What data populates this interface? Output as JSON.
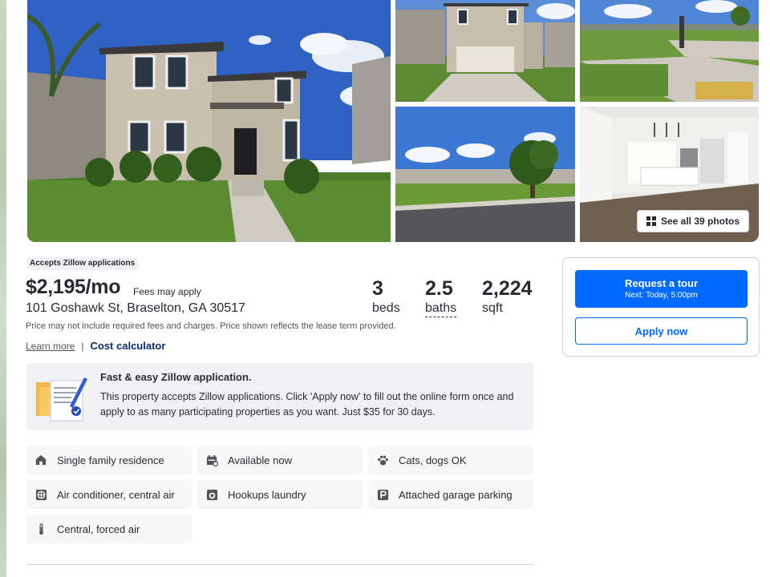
{
  "gallery": {
    "see_all_label": "See all 39 photos"
  },
  "listing": {
    "badge": "Accepts Zillow applications",
    "price": "$2,195/mo",
    "fees_note": "Fees may apply",
    "address": "101 Goshawk St, Braselton, GA 30517",
    "disclaimer": "Price may not include required fees and charges. Price shown reflects the lease term provided.",
    "learn_more": "Learn more",
    "separator": "|",
    "cost_calculator": "Cost calculator",
    "stats": [
      {
        "value": "3",
        "label": "beds"
      },
      {
        "value": "2.5",
        "label": "baths"
      },
      {
        "value": "2,224",
        "label": "sqft"
      }
    ]
  },
  "actions": {
    "tour_label": "Request a tour",
    "tour_sub": "Next: Today, 5:00pm",
    "apply_label": "Apply now",
    "primary_color": "#006aff"
  },
  "application_box": {
    "title": "Fast & easy Zillow application.",
    "body": "This property accepts Zillow applications. Click 'Apply now' to fill out the online form once and apply to as many participating properties as you want. Just $35 for 30 days."
  },
  "facts": [
    {
      "icon": "house-icon",
      "text": "Single family residence"
    },
    {
      "icon": "calendar-icon",
      "text": "Available now"
    },
    {
      "icon": "paw-icon",
      "text": "Cats, dogs OK"
    },
    {
      "icon": "air-conditioner-icon",
      "text": "Air conditioner, central air"
    },
    {
      "icon": "laundry-icon",
      "text": "Hookups laundry"
    },
    {
      "icon": "parking-icon",
      "text": "Attached garage parking"
    },
    {
      "icon": "thermometer-icon",
      "text": "Central, forced air"
    }
  ]
}
